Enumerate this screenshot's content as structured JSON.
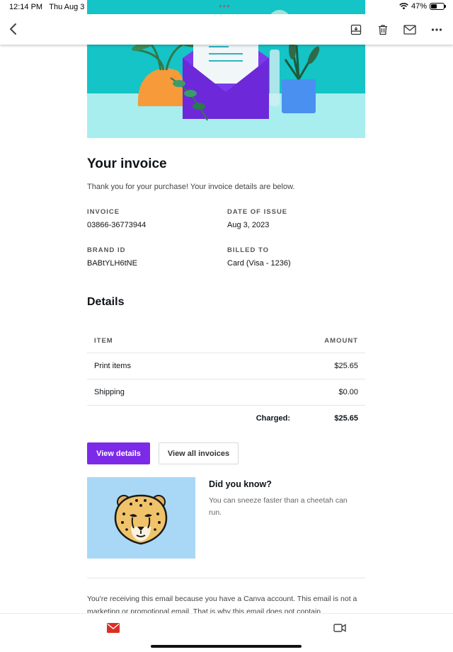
{
  "status_bar": {
    "time": "12:14 PM",
    "date": "Thu Aug 3",
    "battery": "47%",
    "battery_level": 0.47
  },
  "toolbar": {
    "icons": [
      "back-chevron-icon",
      "archive-icon",
      "trash-icon",
      "mail-icon",
      "more-icon"
    ]
  },
  "email": {
    "title": "Your invoice",
    "intro": "Thank you for your purchase! Your invoice details are below.",
    "meta": {
      "invoice_label": "INVOICE",
      "invoice_value": "03866-36773944",
      "date_label": "DATE OF ISSUE",
      "date_value": "Aug 3, 2023",
      "brand_label": "BRAND ID",
      "brand_value": "BABtYLH6tNE",
      "billed_label": "BILLED TO",
      "billed_value": "Card (Visa - 1236)"
    },
    "details": {
      "heading": "Details",
      "columns": {
        "item": "ITEM",
        "amount": "AMOUNT"
      },
      "rows": [
        {
          "item": "Print items",
          "amount": "$25.65"
        },
        {
          "item": "Shipping",
          "amount": "$0.00"
        }
      ],
      "total_label": "Charged:",
      "total_value": "$25.65"
    },
    "buttons": {
      "view_details": "View details",
      "view_all_invoices": "View all invoices"
    },
    "did_you_know": {
      "title": "Did you know?",
      "text": "You can sneeze faster than a cheetah can run."
    },
    "footer": "You're receiving this email because you have a Canva account. This email is not a marketing or promotional email. That is why this email does not contain"
  },
  "colors": {
    "accent": "#7d2ae8",
    "hero_bg": "#14c4c6",
    "hero_floor": "#a8eeee",
    "dyk_bg": "#a9d8f6",
    "mail_red": "#d93025"
  }
}
